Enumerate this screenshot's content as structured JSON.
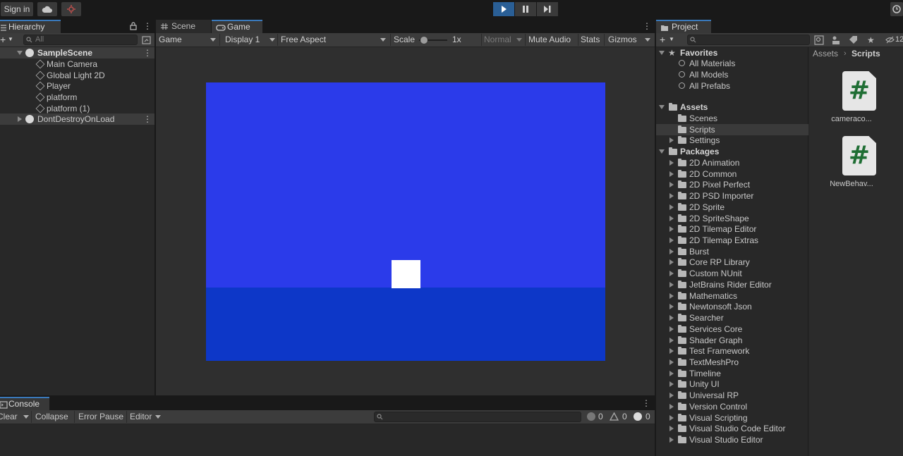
{
  "toolbar": {
    "sign_in": "Sign in",
    "layers_count": "12"
  },
  "hierarchy": {
    "tab_label": "Hierarchy",
    "search_placeholder": "All",
    "scene_name": "SampleScene",
    "objects": [
      "Main Camera",
      "Global Light 2D",
      "Player",
      "platform",
      "platform (1)"
    ],
    "dont_destroy": "DontDestroyOnLoad"
  },
  "game": {
    "tabs": [
      "Scene",
      "Game"
    ],
    "mode": "Game",
    "display": "Display 1",
    "aspect": "Free Aspect",
    "scale_label": "Scale",
    "scale_value": "1x",
    "normal": "Normal",
    "mute_audio": "Mute Audio",
    "stats": "Stats",
    "gizmos": "Gizmos",
    "colors": {
      "sky": "#2b3bea",
      "ground": "#0d37c8",
      "player": "#ffffff"
    }
  },
  "console": {
    "tab_label": "Console",
    "clear": "Clear",
    "collapse": "Collapse",
    "error_pause": "Error Pause",
    "editor": "Editor",
    "info_count": "0",
    "warn_count": "0",
    "error_count": "0"
  },
  "project": {
    "tab_label": "Project",
    "breadcrumb": [
      "Assets",
      "Scripts"
    ],
    "favorites_header": "Favorites",
    "favorites": [
      "All Materials",
      "All Models",
      "All Prefabs"
    ],
    "assets_header": "Assets",
    "assets": [
      "Scenes",
      "Scripts",
      "Settings"
    ],
    "packages_header": "Packages",
    "packages": [
      "2D Animation",
      "2D Common",
      "2D Pixel Perfect",
      "2D PSD Importer",
      "2D Sprite",
      "2D SpriteShape",
      "2D Tilemap Editor",
      "2D Tilemap Extras",
      "Burst",
      "Core RP Library",
      "Custom NUnit",
      "JetBrains Rider Editor",
      "Mathematics",
      "Newtonsoft Json",
      "Searcher",
      "Services Core",
      "Shader Graph",
      "Test Framework",
      "TextMeshPro",
      "Timeline",
      "Unity UI",
      "Universal RP",
      "Version Control",
      "Visual Scripting",
      "Visual Studio Code Editor",
      "Visual Studio Editor"
    ],
    "files": [
      "cameraco...",
      "NewBehav..."
    ]
  }
}
